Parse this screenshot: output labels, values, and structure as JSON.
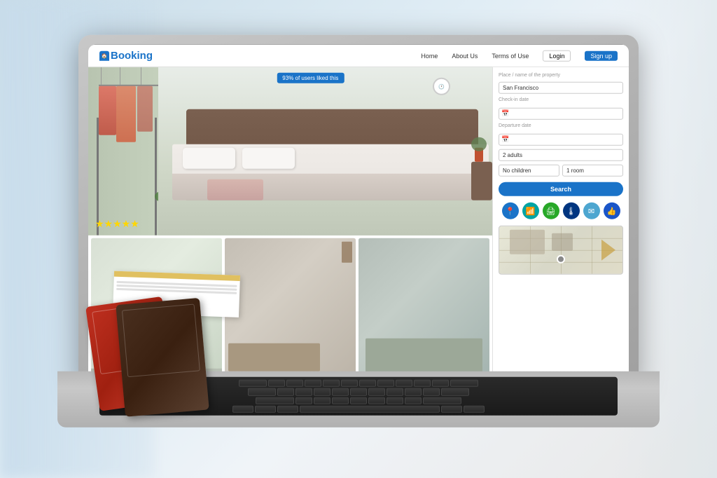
{
  "scene": {
    "description": "Laptop with booking website shown, travel items on table"
  },
  "webpage": {
    "nav": {
      "logo": "Booking",
      "logo_icon": "🏠",
      "links": [
        "Home",
        "About Us",
        "Terms of Use"
      ],
      "login_label": "Login",
      "signup_label": "Sign up"
    },
    "liked_badge": "93% of users liked this",
    "stars": "★★★★★",
    "search_panel": {
      "place_label": "Place / name of the property",
      "place_value": "San Francisco",
      "checkin_label": "Check-in date",
      "checkin_value": "",
      "checkout_label": "Departure date",
      "checkout_value": "",
      "guests_value": "2 adults",
      "children_value": "No children",
      "rooms_value": "1 room",
      "search_button": "Search"
    },
    "amenities": {
      "icons": [
        "📍",
        "📶",
        "🖨",
        "🌡",
        "✉",
        "👍"
      ]
    }
  }
}
